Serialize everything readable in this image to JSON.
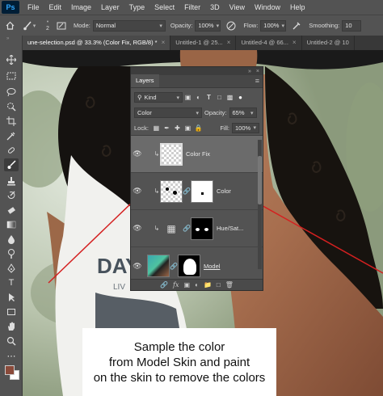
{
  "menubar": {
    "logo": "Ps",
    "items": [
      "File",
      "Edit",
      "Image",
      "Layer",
      "Type",
      "Select",
      "Filter",
      "3D",
      "View",
      "Window",
      "Help"
    ]
  },
  "options": {
    "brush_size": "2",
    "mode_label": "Mode:",
    "mode_value": "Normal",
    "opacity_label": "Opacity:",
    "opacity_value": "100%",
    "flow_label": "Flow:",
    "flow_value": "100%",
    "smoothing_label": "Smoothing:",
    "smoothing_value": "10"
  },
  "tabs": [
    {
      "label": "une-selection.psd @ 33.3% (Color Fix, RGB/8) *",
      "active": true
    },
    {
      "label": "Untitled-1 @ 25...",
      "active": false
    },
    {
      "label": "Untitled-4 @ 66...",
      "active": false
    },
    {
      "label": "Untitled-2 @ 10",
      "active": false
    }
  ],
  "layers_panel": {
    "collapse": "»",
    "close": "×",
    "tab": "Layers",
    "filter_kind": "Kind",
    "blend_mode": "Color",
    "opacity_label": "Opacity:",
    "opacity_value": "65%",
    "lock_label": "Lock:",
    "fill_label": "Fill:",
    "fill_value": "100%",
    "layers": [
      {
        "name": "Color Fix",
        "active": true
      },
      {
        "name": "Color",
        "active": false
      },
      {
        "name": "Hue/Sat...",
        "active": false
      },
      {
        "name": "Model",
        "active": false
      }
    ]
  },
  "canvas": {
    "shirt_text": "DAY",
    "shirt_subtext": "LIV"
  },
  "colors": {
    "foreground": "#8a4a3a",
    "background": "#ffffff",
    "annotation_line": "#d42020"
  },
  "caption": {
    "line1": "Sample the color",
    "line2": "from Model Skin and paint",
    "line3": "on the skin to remove the colors"
  }
}
